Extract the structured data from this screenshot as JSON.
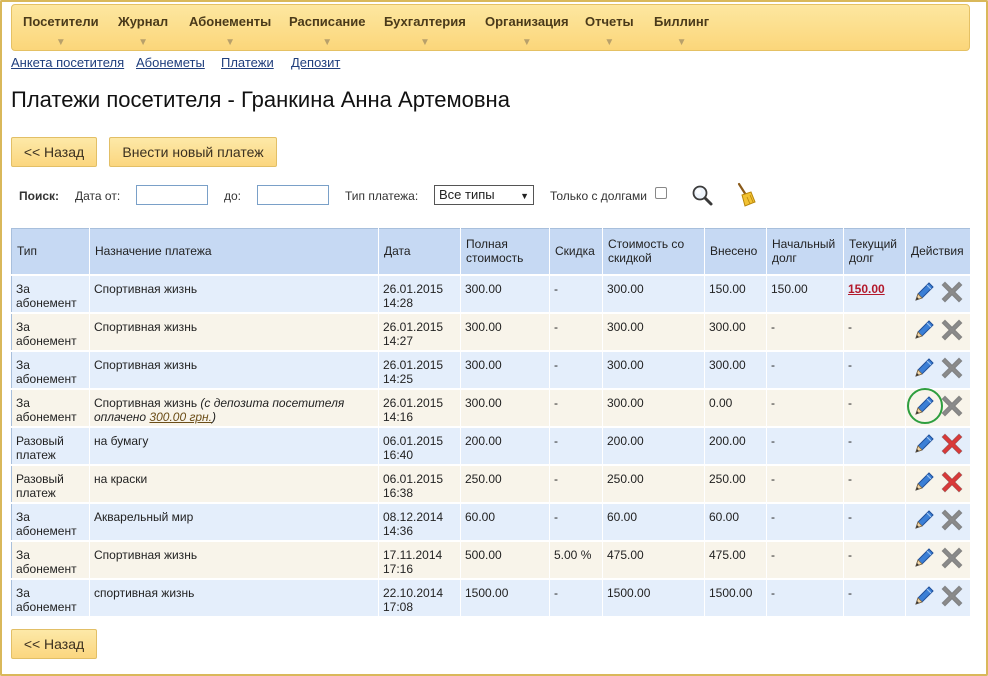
{
  "nav": {
    "items": [
      "Посетители",
      "Журнал",
      "Абонементы",
      "Расписание",
      "Бухгалтерия",
      "Организация",
      "Отчеты",
      "Биллинг"
    ]
  },
  "subnav": {
    "links": [
      "Анкета посетителя",
      "Абонеметы",
      "Платежи",
      "Депозит"
    ]
  },
  "page": {
    "title": "Платежи посетителя - Гранкина Анна Артемовна"
  },
  "buttons": {
    "back": "<< Назад",
    "new_payment": "Внести новый платеж",
    "back_bottom": "<< Назад"
  },
  "search": {
    "label": "Поиск:",
    "date_from_label": "Дата от:",
    "date_from_value": "",
    "date_to_label": "до:",
    "date_to_value": "",
    "type_label": "Тип платежа:",
    "type_selected": "Все типы",
    "only_debts_label": "Только с долгами",
    "only_debts_checked": false
  },
  "table": {
    "headers": [
      "Тип",
      "Назначение платежа",
      "Дата",
      "Полная стоимость",
      "Скидка",
      "Стоимость со скидкой",
      "Внесено",
      "Начальный долг",
      "Текущий долг",
      "Действия"
    ],
    "rows": [
      {
        "type": "За абонемент",
        "purpose": "Спортивная жизнь",
        "note_pre": "",
        "note_amount": "",
        "note_post": "",
        "date": "26.01.2015",
        "time": "14:28",
        "full": "300.00",
        "discount": "-",
        "discounted": "300.00",
        "paid": "150.00",
        "initial_debt": "150.00",
        "current_debt": "150.00",
        "delete_active": false
      },
      {
        "type": "За абонемент",
        "purpose": "Спортивная жизнь",
        "note_pre": "",
        "note_amount": "",
        "note_post": "",
        "date": "26.01.2015",
        "time": "14:27",
        "full": "300.00",
        "discount": "-",
        "discounted": "300.00",
        "paid": "300.00",
        "initial_debt": "-",
        "current_debt": "-",
        "delete_active": false
      },
      {
        "type": "За абонемент",
        "purpose": "Спортивная жизнь",
        "note_pre": "",
        "note_amount": "",
        "note_post": "",
        "date": "26.01.2015",
        "time": "14:25",
        "full": "300.00",
        "discount": "-",
        "discounted": "300.00",
        "paid": "300.00",
        "initial_debt": "-",
        "current_debt": "-",
        "delete_active": false
      },
      {
        "type": "За абонемент",
        "purpose": "Спортивная жизнь",
        "note_pre": "(с депозита посетителя оплачено ",
        "note_amount": "300.00 грн.",
        "note_post": ")",
        "date": "26.01.2015",
        "time": "14:16",
        "full": "300.00",
        "discount": "-",
        "discounted": "300.00",
        "paid": "0.00",
        "initial_debt": "-",
        "current_debt": "-",
        "delete_active": false
      },
      {
        "type": "Разовый платеж",
        "purpose": "на бумагу",
        "note_pre": "",
        "note_amount": "",
        "note_post": "",
        "date": "06.01.2015",
        "time": "16:40",
        "full": "200.00",
        "discount": "-",
        "discounted": "200.00",
        "paid": "200.00",
        "initial_debt": "-",
        "current_debt": "-",
        "delete_active": true
      },
      {
        "type": "Разовый платеж",
        "purpose": "на краски",
        "note_pre": "",
        "note_amount": "",
        "note_post": "",
        "date": "06.01.2015",
        "time": "16:38",
        "full": "250.00",
        "discount": "-",
        "discounted": "250.00",
        "paid": "250.00",
        "initial_debt": "-",
        "current_debt": "-",
        "delete_active": true
      },
      {
        "type": "За абонемент",
        "purpose": "Акварельный мир",
        "note_pre": "",
        "note_amount": "",
        "note_post": "",
        "date": "08.12.2014",
        "time": "14:36",
        "full": "60.00",
        "discount": "-",
        "discounted": "60.00",
        "paid": "60.00",
        "initial_debt": "-",
        "current_debt": "-",
        "delete_active": false
      },
      {
        "type": "За абонемент",
        "purpose": "Спортивная жизнь",
        "note_pre": "",
        "note_amount": "",
        "note_post": "",
        "date": "17.11.2014",
        "time": "17:16",
        "full": "500.00",
        "discount": "5.00 %",
        "discounted": "475.00",
        "paid": "475.00",
        "initial_debt": "-",
        "current_debt": "-",
        "delete_active": false
      },
      {
        "type": "За абонемент",
        "purpose": "спортивная жизнь",
        "note_pre": "",
        "note_amount": "",
        "note_post": "",
        "date": "22.10.2014",
        "time": "17:08",
        "full": "1500.00",
        "discount": "-",
        "discounted": "1500.00",
        "paid": "1500.00",
        "initial_debt": "-",
        "current_debt": "-",
        "delete_active": false
      }
    ]
  },
  "colors": {
    "nav_bg": "#fbd67a",
    "header_bg": "#c6d9f3",
    "row_odd": "#e4eefb",
    "row_even": "#f8f4ea",
    "debt": "#b3192b",
    "delete_active": "#d93a3a",
    "delete_inactive": "#8a8a8a",
    "edit": "#2d6bc4",
    "highlight_ring": "#2e9e3e"
  },
  "icons": [
    "chevron-down-icon",
    "search-icon",
    "broom-icon",
    "pencil-icon",
    "delete-icon"
  ]
}
